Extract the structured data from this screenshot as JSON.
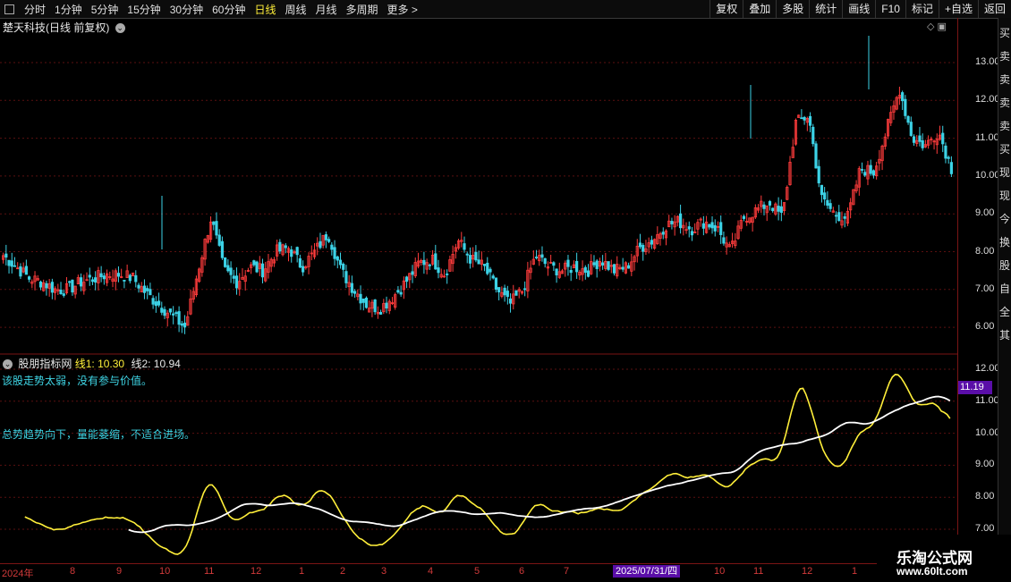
{
  "toolbar": {
    "periods": [
      "分时",
      "1分钟",
      "5分钟",
      "15分钟",
      "30分钟",
      "60分钟",
      "日线",
      "周线",
      "月线",
      "多周期",
      "更多 >"
    ],
    "active": "日线",
    "right_buttons": [
      "复权",
      "叠加",
      "多股",
      "统计",
      "画线",
      "F10",
      "标记",
      "+自选",
      "返回"
    ]
  },
  "main_title": "楚天科技(日线 前复权)",
  "indicator": {
    "name": "股朋指标网",
    "line1_label": "线1:",
    "line1_value": "10.30",
    "line2_label": "线2:",
    "line2_value": "10.94",
    "msg1": "该股走势太弱，没有参与价值。",
    "msg2": "总势趋势向下，量能萎缩，不适合进场。",
    "current_tag": "11.19"
  },
  "price_axis": [
    "13.00",
    "12.00",
    "11.00",
    "10.00",
    "9.00",
    "8.00",
    "7.00",
    "6.00"
  ],
  "ind_axis": [
    "12.00",
    "11.00",
    "10.00",
    "9.00",
    "8.00",
    "7.00"
  ],
  "dates": [
    "2024年",
    "8",
    "9",
    "10",
    "11",
    "12",
    "1",
    "2",
    "3",
    "4",
    "5",
    "6",
    "7",
    "10",
    "11",
    "12",
    "1"
  ],
  "date_box": "2025/07/31/四",
  "right_strip": [
    "买",
    "卖",
    "卖",
    "卖",
    "卖",
    "买",
    "现",
    "现",
    "今",
    "换",
    "股",
    "自",
    "全",
    "其"
  ],
  "watermark": {
    "line1": "乐淘公式网",
    "line2": "www.60lt.com"
  },
  "colors": {
    "up": "#ff3c3c",
    "down": "#3cd2e6",
    "line1": "#ffef3a",
    "line2": "#ffffff"
  },
  "chart_data": {
    "type": "candlestick",
    "close_series": [
      7.9,
      7.6,
      7.3,
      7.2,
      7.0,
      7.0,
      7.2,
      7.3,
      7.4,
      7.4,
      7.3,
      6.9,
      6.6,
      6.3,
      6.0,
      7.5,
      8.9,
      7.5,
      7.2,
      7.6,
      7.5,
      8.0,
      8.1,
      7.6,
      8.0,
      8.5,
      7.5,
      7.0,
      6.6,
      6.5,
      6.8,
      7.2,
      7.7,
      7.8,
      7.4,
      8.3,
      7.8,
      7.6,
      7.0,
      6.6,
      7.0,
      7.9,
      7.6,
      7.5,
      7.6,
      7.5,
      7.8,
      7.5,
      7.6,
      8.1,
      8.3,
      8.7,
      8.8,
      8.6,
      8.8,
      8.6,
      8.0,
      8.9,
      9.1,
      9.3,
      8.9,
      11.4,
      11.6,
      9.4,
      9.0,
      8.9,
      10.2,
      10.1,
      11.2,
      12.3,
      11.0,
      10.8,
      11.2,
      10.2
    ],
    "ind_line1_range": [
      6.8,
      11.9
    ],
    "ind_line2_range": [
      6.9,
      10.9
    ]
  }
}
